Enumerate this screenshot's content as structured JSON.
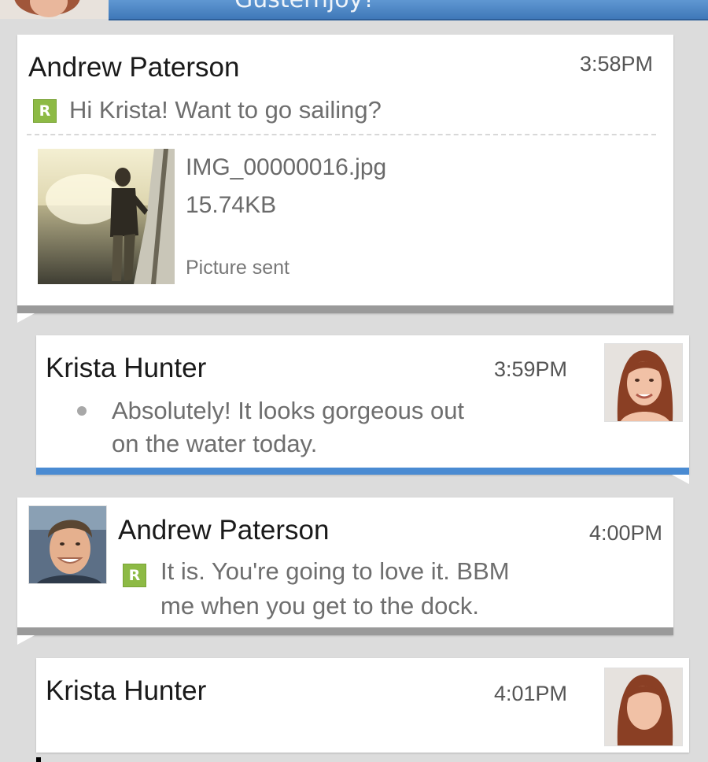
{
  "header": {
    "title": "Gusternjoy?"
  },
  "messages": [
    {
      "sender": "Andrew Paterson",
      "time": "3:58PM",
      "status_badge": "R",
      "text": "Hi Krista! Want to go sailing?",
      "attachment": {
        "file_name": "IMG_00000016.jpg",
        "file_size": "15.74KB",
        "status": "Picture sent"
      }
    },
    {
      "sender": "Krista Hunter",
      "time": "3:59PM",
      "text_line1": "Absolutely! It looks gorgeous out",
      "text_line2": "on the water today."
    },
    {
      "sender": "Andrew Paterson",
      "time": "4:00PM",
      "status_badge": "R",
      "text_line1": "It is. You're going to love it. BBM",
      "text_line2": "me when you get to the dock."
    },
    {
      "sender": "Krista Hunter",
      "time": "4:01PM"
    }
  ],
  "colors": {
    "background": "#dcdcdc",
    "header_blue": "#4a84c4",
    "read_badge_green": "#8dba45",
    "outgoing_accent_blue": "#4a8bd2",
    "incoming_shadow_gray": "#9a9a9a"
  }
}
